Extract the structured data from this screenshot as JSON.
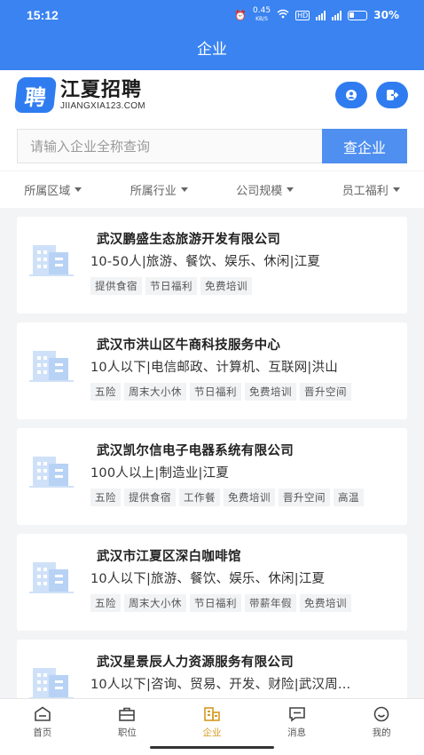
{
  "status_bar": {
    "time": "15:12",
    "net_speed": "0.45",
    "net_unit": "KB/S",
    "battery": "30%"
  },
  "page_title": "企业",
  "brand": {
    "logo_char": "聘",
    "name": "江夏招聘",
    "url": "JIIANGXIA123.COM"
  },
  "search": {
    "placeholder": "请输入企业全称查询",
    "button": "查企业"
  },
  "filters": [
    "所属区域",
    "所属行业",
    "公司规模",
    "员工福利"
  ],
  "companies": [
    {
      "name": "武汉鹏盛生态旅游开发有限公司",
      "meta": "10-50人|旅游、餐饮、娱乐、休闲|江夏",
      "tags": [
        "提供食宿",
        "节日福利",
        "免费培训"
      ]
    },
    {
      "name": "武汉市洪山区牛商科技服务中心",
      "meta": "10人以下|电信邮政、计算机、互联网|洪山",
      "tags": [
        "五险",
        "周末大小休",
        "节日福利",
        "免费培训",
        "晋升空间"
      ]
    },
    {
      "name": "武汉凯尔信电子电器系统有限公司",
      "meta": "100人以上|制造业|江夏",
      "tags": [
        "五险",
        "提供食宿",
        "工作餐",
        "免费培训",
        "晋升空间",
        "高温"
      ]
    },
    {
      "name": "武汉市江夏区深白咖啡馆",
      "meta": "10人以下|旅游、餐饮、娱乐、休闲|江夏",
      "tags": [
        "五险",
        "周末大小休",
        "节日福利",
        "带薪年假",
        "免费培训"
      ]
    },
    {
      "name": "武汉星景辰人力资源服务有限公司",
      "meta": "10人以下|咨询、贸易、开发、财险|武汉周...",
      "tags": []
    }
  ],
  "tabs": [
    {
      "label": "首页",
      "icon": "home-icon"
    },
    {
      "label": "职位",
      "icon": "briefcase-icon"
    },
    {
      "label": "企业",
      "icon": "building-icon",
      "active": true
    },
    {
      "label": "消息",
      "icon": "message-icon"
    },
    {
      "label": "我的",
      "icon": "profile-icon"
    }
  ],
  "colors": {
    "primary": "#3a83f1",
    "active_tab": "#d49a1e"
  }
}
